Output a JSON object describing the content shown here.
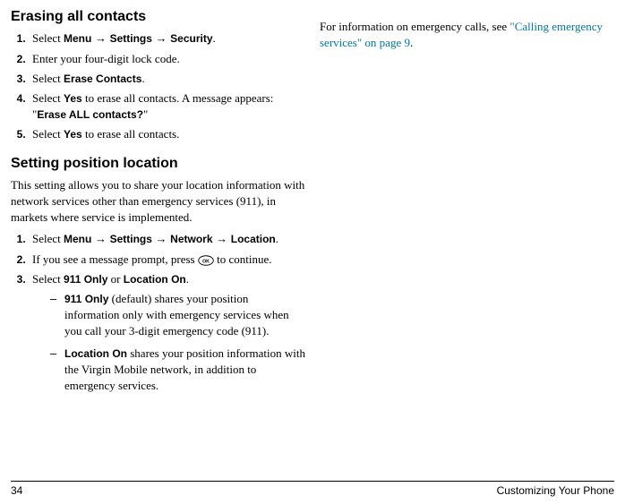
{
  "left": {
    "heading1": "Erasing all contacts",
    "step1_pre": "Select ",
    "step1_menu": "Menu",
    "step1_arrow1": " → ",
    "step1_settings": "Settings",
    "step1_arrow2": " → ",
    "step1_security": "Security",
    "step1_post": ".",
    "step2": "Enter your four-digit lock code.",
    "step3_pre": "Select ",
    "step3_bold": "Erase Contacts",
    "step3_post": ".",
    "step4_pre": "Select ",
    "step4_yes": "Yes",
    "step4_mid": " to erase all contacts. A message appears: \"",
    "step4_bold": "Erase ALL contacts?",
    "step4_post": "\"",
    "step5_pre": "Select ",
    "step5_yes": "Yes",
    "step5_post": " to erase all contacts.",
    "heading2": "Setting position location",
    "intro": "This setting allows you to share your location information with network services other than emergency services (911), in markets where service is implemented.",
    "loc_step1_pre": "Select ",
    "loc_step1_menu": "Menu",
    "loc_step1_a1": " → ",
    "loc_step1_settings": "Settings",
    "loc_step1_a2": " → ",
    "loc_step1_network": "Network",
    "loc_step1_a3": " → ",
    "loc_step1_location": "Location",
    "loc_step1_post": ".",
    "loc_step2_pre": "If you see a message prompt, press ",
    "loc_step2_post": " to continue.",
    "loc_step3_pre": "Select ",
    "loc_step3_opt1": "911 Only",
    "loc_step3_or": " or ",
    "loc_step3_opt2": "Location On",
    "loc_step3_post": ".",
    "sub1_bold": "911 Only",
    "sub1_text": " (default) shares your position information only with emergency services when you call your 3-digit emergency code (911).",
    "sub2_bold": "Location On",
    "sub2_text": " shares your position information with the Virgin Mobile network, in addition to emergency services."
  },
  "right": {
    "text_pre": "For information on emergency calls, see ",
    "link": "\"Calling emergency services\" on page 9",
    "text_post": "."
  },
  "footer": {
    "page": "34",
    "title": "Customizing Your Phone"
  }
}
